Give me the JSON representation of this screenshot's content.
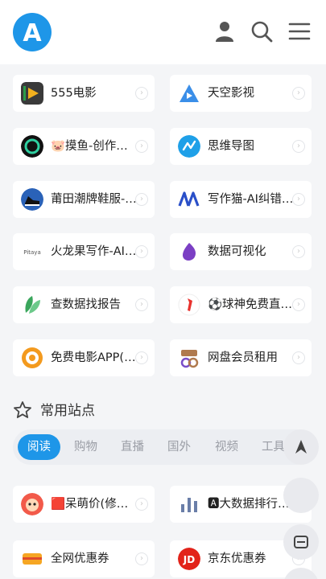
{
  "header": {
    "logo_letter": "A"
  },
  "cards": [
    {
      "label": "555电影"
    },
    {
      "label": "天空影视"
    },
    {
      "label": "🐷摸鱼-创作…"
    },
    {
      "label": "思维导图"
    },
    {
      "label": "莆田潮牌鞋服-…"
    },
    {
      "label": "写作猫-AI纠错…"
    },
    {
      "label": "火龙果写作-AI…"
    },
    {
      "label": "数据可视化"
    },
    {
      "label": "查数据找报告"
    },
    {
      "label": "⚽球神免费直…"
    },
    {
      "label": "免费电影APP(…"
    },
    {
      "label": "网盘会员租用"
    },
    {
      "label": "🟥呆萌价(修…"
    },
    {
      "label": "🅰大数据排行…"
    },
    {
      "label": "全网优惠券"
    },
    {
      "label": "京东优惠券"
    }
  ],
  "section": {
    "title": "常用站点"
  },
  "tabs": [
    "阅读",
    "购物",
    "直播",
    "国外",
    "视频",
    "工具"
  ],
  "icons": {
    "jd_text": "JD",
    "pitaya_text": "Pitaya"
  },
  "colors": {
    "accent": "#1e96e8"
  }
}
